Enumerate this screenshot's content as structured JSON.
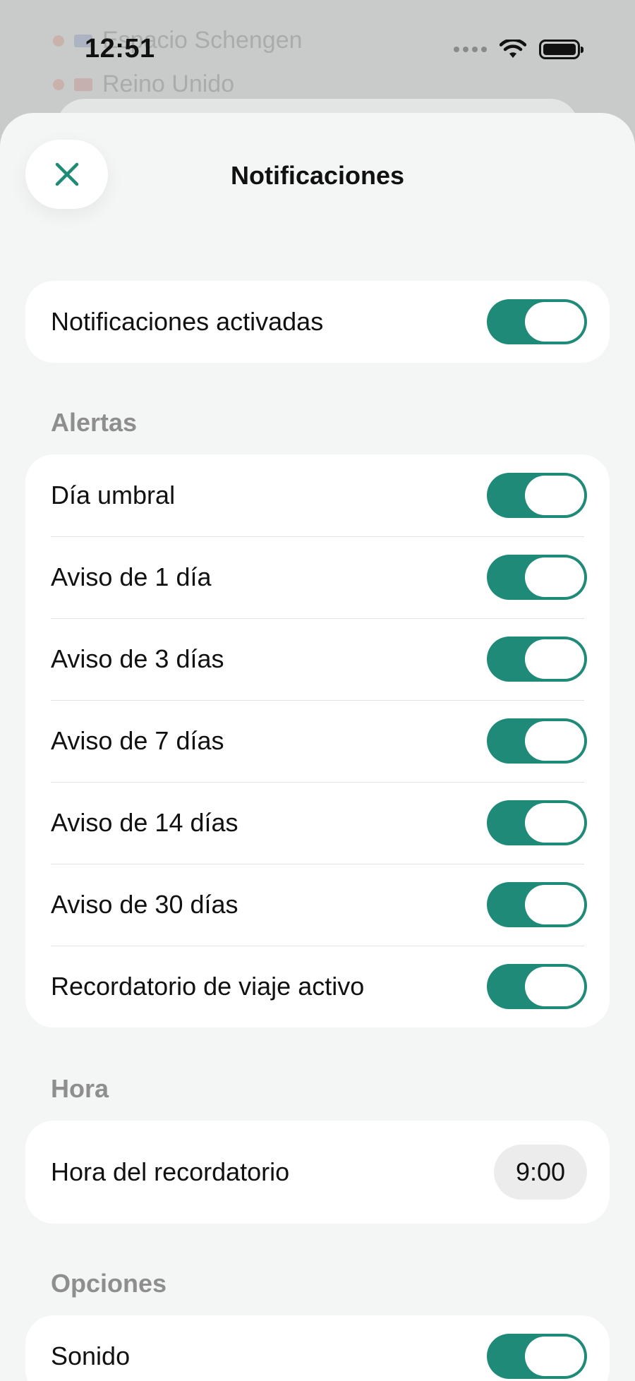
{
  "background": {
    "row1_text": "Espacio Schengen",
    "row2_text": "Reino Unido"
  },
  "status_bar": {
    "time": "12:51",
    "icons": [
      "signal-icon",
      "wifi-icon",
      "battery-icon"
    ]
  },
  "sheet": {
    "title": "Notificaciones",
    "close_icon": "close-icon"
  },
  "main_toggle": {
    "label": "Notificaciones activadas",
    "on": true
  },
  "alerts": {
    "heading": "Alertas",
    "items": [
      {
        "label": "Día umbral",
        "on": true
      },
      {
        "label": "Aviso de 1 día",
        "on": true
      },
      {
        "label": "Aviso de 3 días",
        "on": true
      },
      {
        "label": "Aviso de 7 días",
        "on": true
      },
      {
        "label": "Aviso de 14 días",
        "on": true
      },
      {
        "label": "Aviso de 30 días",
        "on": true
      },
      {
        "label": "Recordatorio de viaje activo",
        "on": true
      }
    ]
  },
  "time_section": {
    "heading": "Hora",
    "label": "Hora del recordatorio",
    "value": "9:00"
  },
  "options": {
    "heading": "Opciones",
    "items": [
      {
        "label": "Sonido",
        "on": true
      }
    ]
  },
  "colors": {
    "accent": "#1f8a78",
    "sheet_bg": "#f4f5f5",
    "card_bg": "#ffffff",
    "section_label": "#8e8e8e"
  }
}
